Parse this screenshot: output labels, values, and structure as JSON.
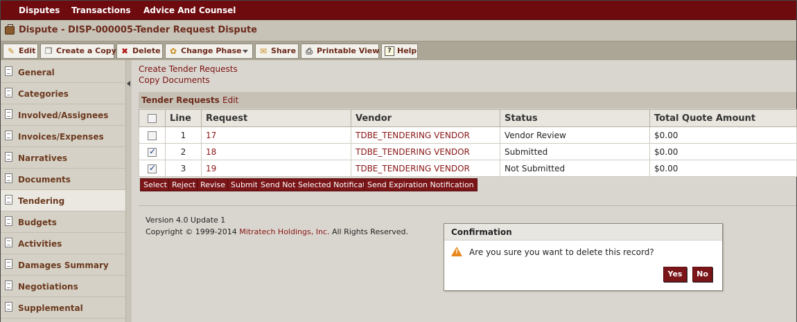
{
  "nav": {
    "items": [
      "Disputes",
      "Transactions",
      "Advice And Counsel"
    ]
  },
  "header": {
    "title": "Dispute - DISP-000005-Tender Request Dispute",
    "icon": "briefcase-icon"
  },
  "toolbar": {
    "edit": "Edit",
    "create_copy": "Create a Copy",
    "delete": "Delete",
    "change_phase": "Change Phase",
    "share": "Share",
    "printable_view": "Printable View",
    "help": "Help"
  },
  "sidebar": {
    "items": [
      {
        "label": "General"
      },
      {
        "label": "Categories"
      },
      {
        "label": "Involved/Assignees"
      },
      {
        "label": "Invoices/Expenses"
      },
      {
        "label": "Narratives"
      },
      {
        "label": "Documents"
      },
      {
        "label": "Tendering"
      },
      {
        "label": "Budgets"
      },
      {
        "label": "Activities"
      },
      {
        "label": "Damages Summary"
      },
      {
        "label": "Negotiations"
      },
      {
        "label": "Supplemental"
      }
    ],
    "active": "Tendering"
  },
  "main": {
    "links": {
      "create_tender": "Create Tender Requests",
      "copy_documents": "Copy Documents"
    },
    "section": {
      "title": "Tender Requests",
      "edit": "Edit"
    },
    "table": {
      "columns": [
        "Line",
        "Request",
        "Vendor",
        "Status",
        "Total Quote Amount"
      ],
      "rows": [
        {
          "checked": false,
          "line": "1",
          "request": "17",
          "vendor": "TDBE_TENDERING VENDOR",
          "status": "Vendor Review",
          "amount": "$0.00"
        },
        {
          "checked": true,
          "line": "2",
          "request": "18",
          "vendor": "TDBE_TENDERING VENDOR",
          "status": "Submitted",
          "amount": "$0.00"
        },
        {
          "checked": true,
          "line": "3",
          "request": "19",
          "vendor": "TDBE_TENDERING VENDOR",
          "status": "Not Submitted",
          "amount": "$0.00"
        }
      ]
    },
    "actions": [
      "Select",
      "Reject",
      "Revise",
      "Submit",
      "Send Not Selected Notification",
      "Send Expiration Notification"
    ],
    "footer": {
      "version": "Version 4.0 Update 1",
      "copyright_prefix": "Copyright © 1999-2014 ",
      "company": "Mitratech Holdings, Inc.",
      "copyright_suffix": " All Rights Reserved."
    }
  },
  "dialog": {
    "title": "Confirmation",
    "message": "Are you sure you want to delete this record?",
    "yes": "Yes",
    "no": "No"
  },
  "colors": {
    "brand": "#6e0b0f",
    "link": "#7a1212",
    "warning": "#e8861a"
  }
}
